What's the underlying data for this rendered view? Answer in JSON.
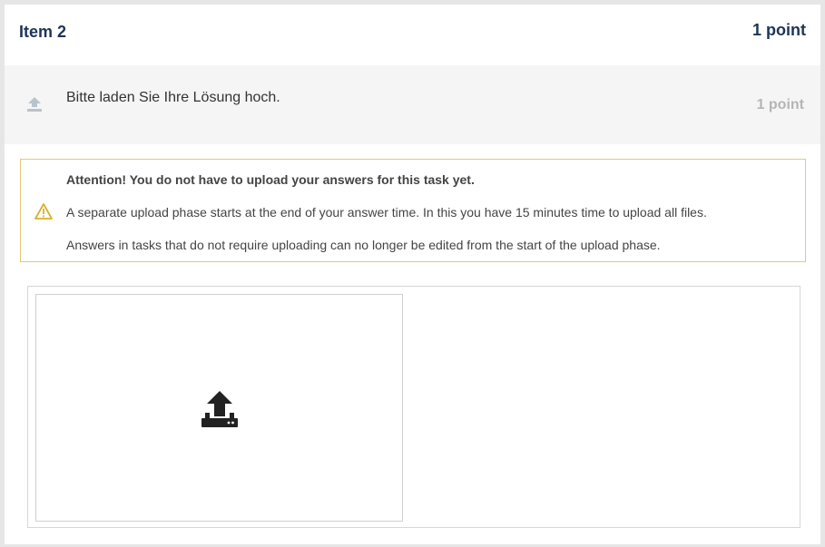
{
  "item": {
    "title": "Item 2",
    "points": "1 point"
  },
  "question": {
    "text": "Bitte laden Sie Ihre Lösung hoch.",
    "points": "1 point",
    "icon": "upload-icon"
  },
  "notice": {
    "icon": "warning-triangle-icon",
    "lines": [
      "Attention! You do not have to upload your answers for this task yet.",
      "A separate upload phase starts at the end of your answer time. In this you have 15 minutes time to upload all files.",
      "Answers in tasks that do not require uploading can no longer be edited from the start of the upload phase."
    ]
  },
  "dropzone": {
    "icon": "upload-file-icon"
  },
  "colors": {
    "title": "#1d3557",
    "notice_border": "#e0cc73",
    "warning": "#d8b12a",
    "muted_points": "#b5b5b5"
  }
}
